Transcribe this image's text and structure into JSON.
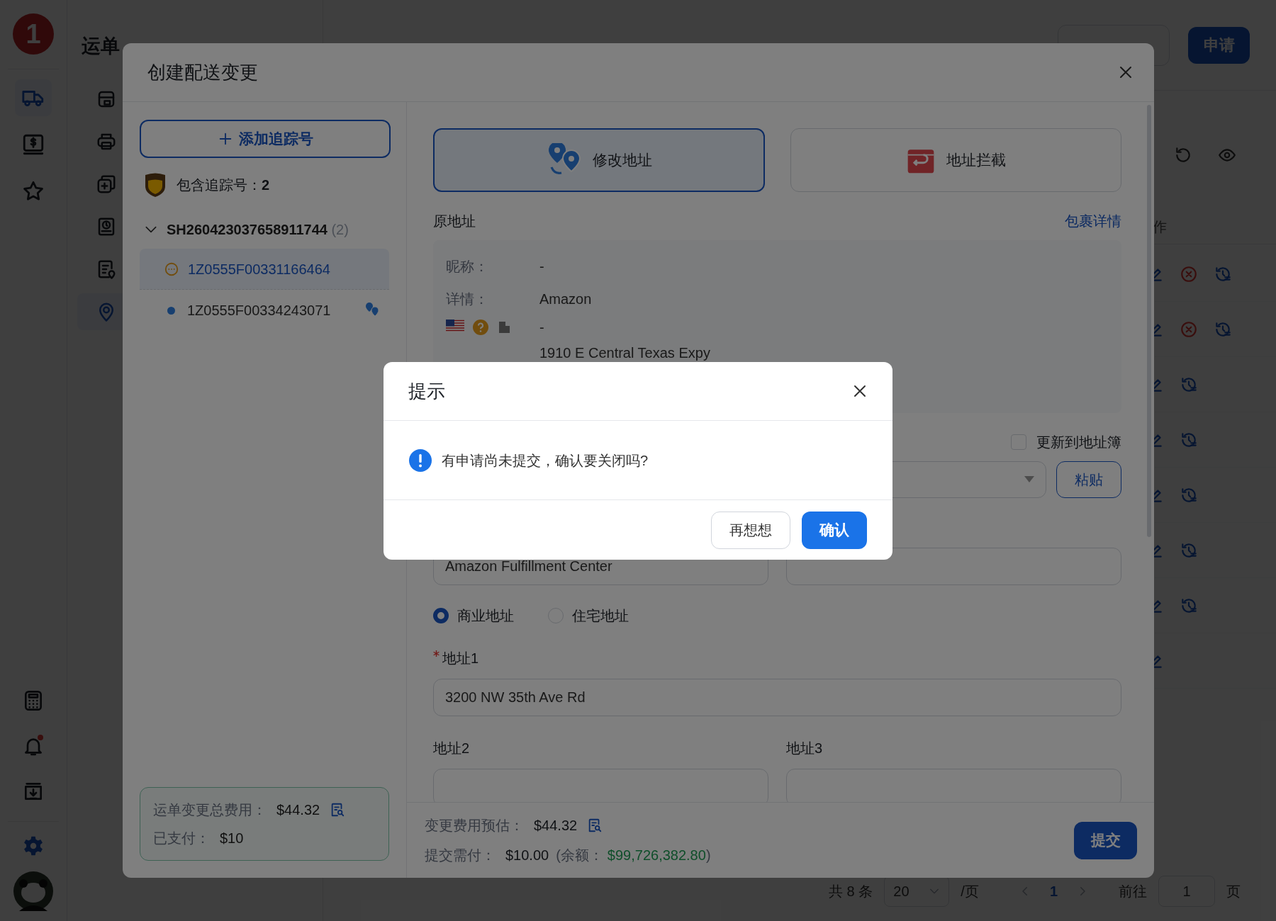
{
  "app_sidebar": {
    "logo": "1",
    "top_items": [
      {
        "selected": true
      },
      {
        "selected": false
      },
      {
        "selected": false
      }
    ],
    "bottom_items": [
      {
        "badge": false
      },
      {
        "badge": true
      },
      {
        "badge": false
      }
    ]
  },
  "submenu": {
    "title": "运单",
    "items": [
      {
        "selected": false
      },
      {
        "selected": false
      },
      {
        "selected": false
      },
      {
        "selected": false
      },
      {
        "selected": false
      },
      {
        "selected": true
      }
    ]
  },
  "header": {
    "apply_button": "申请"
  },
  "table": {
    "action_header": "作",
    "rows": [
      {
        "cancellable": true,
        "restorable": true
      },
      {
        "cancellable": true,
        "restorable": true
      },
      {
        "cancellable": false,
        "restorable": true
      },
      {
        "cancellable": false,
        "restorable": true
      },
      {
        "cancellable": false,
        "restorable": true
      },
      {
        "cancellable": false,
        "restorable": true
      },
      {
        "cancellable": false,
        "restorable": true
      },
      {
        "cancellable": false,
        "restorable": false
      }
    ]
  },
  "pagination": {
    "total": "共 8 条",
    "page_size": "20",
    "per_page": "/页",
    "current_page": "1",
    "goto_label": "前往",
    "goto_value": "1",
    "page_suffix": "页"
  },
  "modal": {
    "title": "创建配送变更",
    "add_button": "添加追踪号",
    "carrier_label": "包含追踪号：",
    "carrier_count": "2",
    "tree": [
      {
        "label": "SH260423037658911744",
        "count": "(2)",
        "expanded": true,
        "children": [
          {
            "label": "1Z0555F00331166464",
            "selected": true,
            "kind": "pending",
            "address_changed": false
          },
          {
            "label": "1Z0555F00334243071",
            "selected": false,
            "kind": "normal",
            "address_changed": true
          }
        ]
      }
    ],
    "summary": [
      {
        "label": "运单变更总费用：",
        "value": "$44.32",
        "receipt": true
      },
      {
        "label": "已支付：",
        "value": "$10",
        "receipt": false
      }
    ],
    "options": [
      {
        "label": "修改地址",
        "selected": true
      },
      {
        "label": "地址拦截",
        "selected": false
      }
    ],
    "original_title": "原地址",
    "details_link": "包裹详情",
    "original_fields": [
      {
        "label": "昵称：",
        "value": "-"
      },
      {
        "label": "详情：",
        "value": "Amazon"
      }
    ],
    "original_lines": [
      "-",
      "1910 E Central Texas Expy"
    ],
    "update_book": {
      "label": "更新到地址簿",
      "checked": false
    },
    "paste_button": "粘贴",
    "company_value": "Amazon Fulfillment Center",
    "address_types": [
      {
        "label": "商业地址",
        "selected": true
      },
      {
        "label": "住宅地址",
        "selected": false
      }
    ],
    "address_fields": [
      {
        "label": "地址1",
        "required": true,
        "value": "3200 NW 35th Ave Rd"
      },
      {
        "label": "地址2",
        "required": false
      },
      {
        "label": "地址3",
        "required": false
      }
    ],
    "footer": {
      "estimate_label": "变更费用预估：",
      "estimate_value": "$44.32",
      "due_label": "提交需付：",
      "due_value": "$10.00",
      "balance_open": "(余额：",
      "balance_value": "$99,726,382.80",
      "balance_close": ")",
      "submit_button": "提交"
    }
  },
  "dialog": {
    "title": "提示",
    "message": "有申请尚未提交，确认要关闭吗?",
    "cancel_button": "再想想",
    "confirm_button": "确认"
  }
}
